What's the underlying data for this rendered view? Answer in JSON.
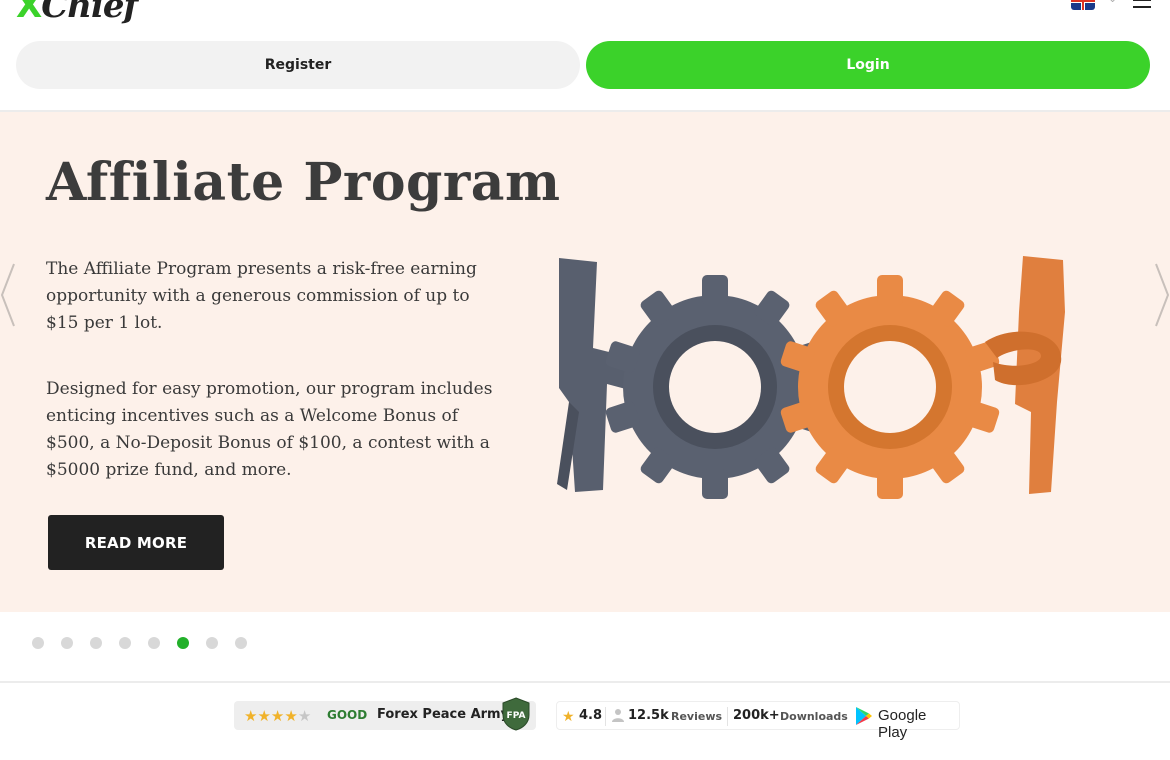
{
  "header": {
    "logo_text": "XChief",
    "register_label": "Register",
    "login_label": "Login",
    "language_icon": "uk-flag-icon",
    "menu_icon": "hamburger-menu-icon"
  },
  "slide": {
    "title": "Affiliate Program",
    "paragraph_1": "The Affiliate Program presents a risk-free earning opportunity with a generous commission of up to $15 per 1 lot.",
    "paragraph_2": "Designed for easy promotion, our program includes enticing incentives such as a Welcome Bonus of $500, a No-Deposit Bonus of $100, a contest with a $5000 prize fund, and more.",
    "read_more_label": "READ MORE",
    "prev_icon": "chevron-left-icon",
    "next_icon": "chevron-right-icon",
    "illustration_icon": "gears-and-figures-illustration"
  },
  "carousel": {
    "dot_count": 8,
    "active_index": 5
  },
  "fpa_badge": {
    "stars_filled": 4,
    "stars_total": 5,
    "rating_text": "GOOD",
    "name": "Forex Peace Army",
    "shield_text": "FPA"
  },
  "google_play_badge": {
    "rating": "4.8",
    "reviews_count": "12.5k",
    "reviews_label": "Reviews",
    "downloads_count": "200k+",
    "downloads_label": "Downloads",
    "store_name": "Google Play"
  },
  "colors": {
    "brand_green": "#3bd22a",
    "slide_background": "#fdf1ea",
    "dot_active": "#22b02a",
    "dot_inactive": "#d8d8d8",
    "button_dark": "#222222"
  }
}
